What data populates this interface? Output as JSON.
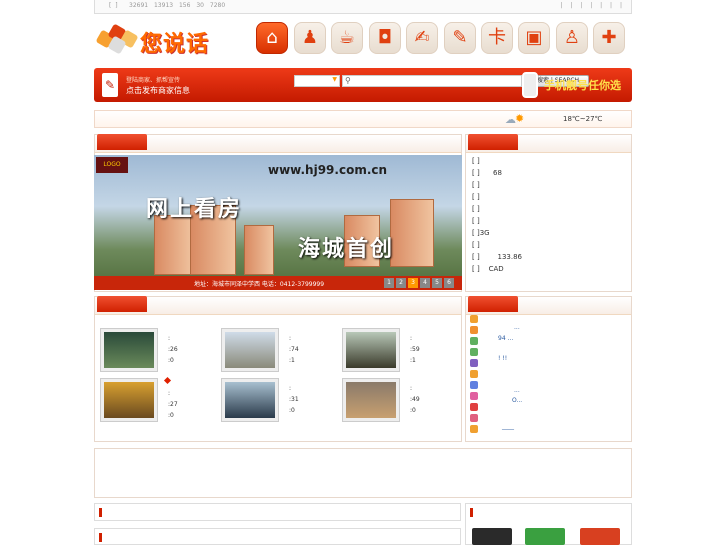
{
  "topbar": {
    "left_brackets": "[ ]",
    "stats": "32691 13913 156 30 7280",
    "right_bars": "| | | | | | |"
  },
  "logo": {
    "text": "您说话"
  },
  "nav_icons": [
    "home-icon",
    "person-running-icon",
    "coffee-cup-icon",
    "shopping-bag-icon",
    "handshake-icon",
    "pencil-note-icon",
    "signpost-icon",
    "tv-icon",
    "user-icon",
    "gift-icon"
  ],
  "header_bar": {
    "line1": "登陆商家、抓帮宣传",
    "line2": "点击发布商家信息",
    "search_button": "搜索 | SEARCH",
    "mobile_promo": "手机靓号任你选"
  },
  "weather": {
    "temperature": "18℃~27℃"
  },
  "banner": {
    "url": "www.hj99.com.cn",
    "headline1": "网上看房",
    "headline2": "海城首创",
    "address": "地址：海城市同泽中学西 电话：0412-3799999",
    "pages": [
      "1",
      "2",
      "3",
      "4",
      "5",
      "6"
    ],
    "active_page": "3"
  },
  "news_list": [
    {
      "b": "[ ]",
      "t": ""
    },
    {
      "b": "[ ]",
      "t": "68"
    },
    {
      "b": "[ ]",
      "t": ""
    },
    {
      "b": "[ ]",
      "t": ""
    },
    {
      "b": "[ ]",
      "t": ""
    },
    {
      "b": "[ ]",
      "t": ""
    },
    {
      "b": "[ ]",
      "t": "3G"
    },
    {
      "b": "[ ]",
      "t": ""
    },
    {
      "b": "[ ]",
      "t": "133.86"
    },
    {
      "b": "[ ]",
      "t": "CAD"
    }
  ],
  "stores": [
    {
      "a": ":",
      "b": ":26",
      "c": ":0"
    },
    {
      "a": ":",
      "b": ":74",
      "c": ":1"
    },
    {
      "a": ":",
      "b": ":59",
      "c": ":1"
    },
    {
      "a": ":",
      "b": ":27",
      "c": ":0"
    },
    {
      "a": ":",
      "b": ":31",
      "c": ":0"
    },
    {
      "a": ":",
      "b": ":49",
      "c": ":0"
    }
  ],
  "right_list": [
    {
      "t": ""
    },
    {
      "t": "..."
    },
    {
      "t": "94 ..."
    },
    {
      "t": ""
    },
    {
      "t": "! !!"
    },
    {
      "t": ""
    },
    {
      "t": ""
    },
    {
      "t": "..."
    },
    {
      "t": "O..."
    },
    {
      "t": ""
    },
    {
      "t": ""
    },
    {
      "t": "____"
    }
  ],
  "colors": {
    "accent": "#d02000",
    "brand_orange": "#ff6a00"
  }
}
